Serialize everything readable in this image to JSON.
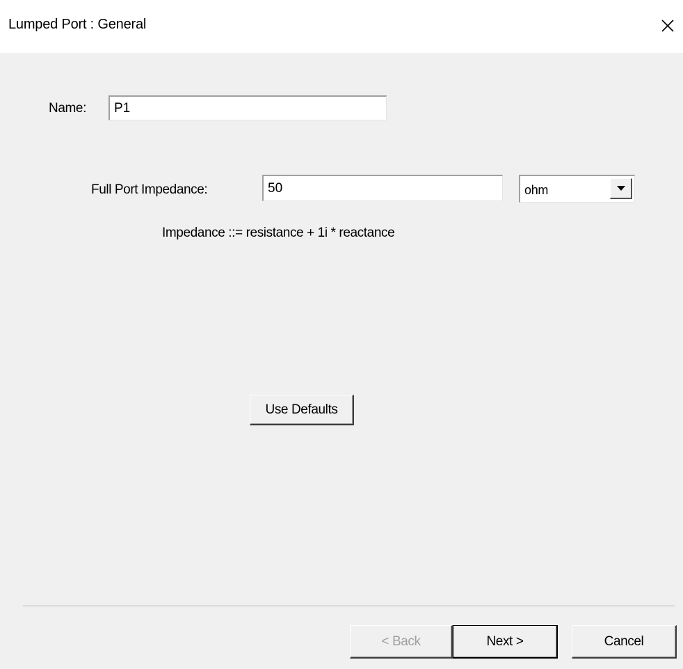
{
  "window": {
    "title": "Lumped Port : General",
    "close_glyph": "✕"
  },
  "form": {
    "name_label": "Name:",
    "name_value": "P1",
    "impedance_label": "Full Port Impedance:",
    "impedance_value": "50",
    "unit_selected": "ohm",
    "impedance_note": "Impedance ::= resistance + 1i * reactance",
    "use_defaults_label": "Use Defaults"
  },
  "footer": {
    "back_label": "< Back",
    "next_label": "Next >",
    "cancel_label": "Cancel"
  },
  "icons": {
    "close": "close-icon",
    "dropdown": "chevron-down-icon"
  },
  "colors": {
    "titlebar_bg": "#ffffff",
    "dialog_bg": "#f0f0f0",
    "disabled_text": "#a0a0a0"
  }
}
